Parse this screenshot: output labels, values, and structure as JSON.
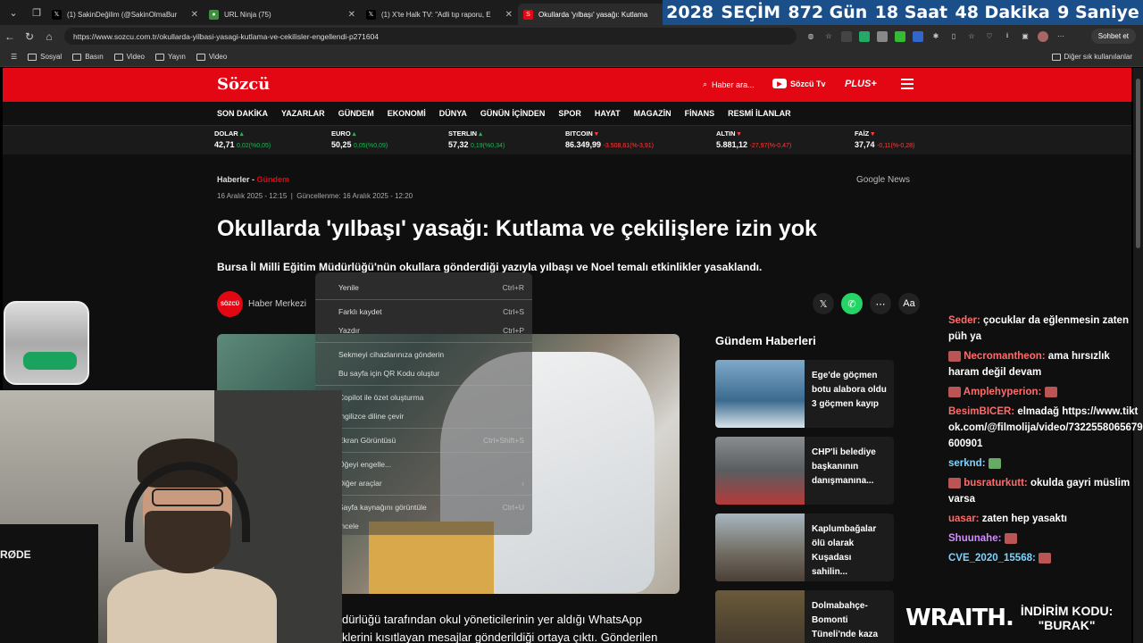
{
  "browser": {
    "tabs": [
      {
        "title": "(1) SakinDeğilim (@SakinOlmaBur",
        "icon": "x-icon",
        "active": false
      },
      {
        "title": "URL Ninja (75)",
        "icon": "url-ninja-icon",
        "active": false
      },
      {
        "title": "(1) X'te Halk TV: \"Adli tıp raporu, E",
        "icon": "x-icon",
        "active": false
      },
      {
        "title": "Okullarda 'yılbaşı' yasağı: Kutlama",
        "icon": "sozcu-icon",
        "active": true
      }
    ],
    "url": "https://www.sozcu.com.tr/okullarda-yilbasi-yasagi-kutlama-ve-cekilisler-engellendi-p271604",
    "chat_button": "Sohbet et",
    "bookmarks": [
      "Sosyal",
      "Basın",
      "Video",
      "Yayın",
      "Video"
    ],
    "bookmarks_other": "Diğer sık kullanılanlar"
  },
  "countdown": {
    "year": "2028",
    "label": "SEÇİM",
    "days": "872 Gün",
    "hours": "18 Saat",
    "minutes": "48 Dakika",
    "seconds": "9 Saniye"
  },
  "site": {
    "logo": "Sözcü",
    "search_placeholder": "Haber ara...",
    "tv": "Sözcü Tv",
    "plus": "PLUS+",
    "menu": [
      "SON DAKİKA",
      "YAZARLAR",
      "GÜNDEM",
      "EKONOMİ",
      "DÜNYA",
      "GÜNÜN İÇİNDEN",
      "SPOR",
      "HAYAT",
      "MAGAZİN",
      "FİNANS",
      "RESMİ İLANLAR"
    ],
    "market": [
      {
        "name": "DOLAR",
        "value": "42,71",
        "change": "0,02(%0,05)",
        "dir": "up"
      },
      {
        "name": "EURO",
        "value": "50,25",
        "change": "0,05(%0,09)",
        "dir": "up"
      },
      {
        "name": "STERLIN",
        "value": "57,32",
        "change": "0,19(%0,34)",
        "dir": "up"
      },
      {
        "name": "BITCOIN",
        "value": "86.349,99",
        "change": "-3.508,61(%-3,91)",
        "dir": "dn"
      },
      {
        "name": "ALTIN",
        "value": "5.881,12",
        "change": "-27,97(%-0,47)",
        "dir": "dn"
      },
      {
        "name": "FAİZ",
        "value": "37,74",
        "change": "-0,11(%-0,28)",
        "dir": "dn"
      }
    ]
  },
  "article": {
    "crumb": "Haberler -",
    "category": "Gündem",
    "published": "16 Aralık 2025 - 12:15",
    "updated": "Güncellenme: 16 Aralık 2025 - 12:20",
    "google_news": "Google News",
    "title": "Okullarda 'yılbaşı' yasağı: Kutlama ve çekilişlere izin yok",
    "subtitle": "Bursa İl Milli Eğitim Müdürlüğü'nün okullara gönderdiği yazıyla yılbaşı ve Noel temalı etkinlikler yasaklandı.",
    "author": "Haber Merkezi",
    "author_badge": "SÖZCÜ",
    "body_line1": "dürlüğü tarafından okul yöneticilerinin yer aldığı WhatsApp",
    "body_line2": "klerini kısıtlayan mesajlar gönderildiği ortaya çıktı. Gönderilen"
  },
  "sidebar": {
    "heading": "Gündem Haberleri",
    "items": [
      {
        "title": "Ege'de göçmen botu alabora oldu 3 göçmen kayıp"
      },
      {
        "title": "CHP'li belediye başkanının danışmanına..."
      },
      {
        "title": "Kaplumbağalar ölü olarak Kuşadası sahilin..."
      },
      {
        "title": "Dolmabahçe-Bomonti Tüneli'nde kaza"
      }
    ]
  },
  "context_menu": [
    {
      "label": "Yenile",
      "key": "Ctrl+R"
    },
    {
      "label": "Farklı kaydet",
      "key": "Ctrl+S"
    },
    {
      "label": "Yazdır",
      "key": "Ctrl+P"
    },
    {
      "label": "Sekmeyi cihazlarınıza gönderin",
      "key": ""
    },
    {
      "label": "Bu sayfa için QR Kodu oluştur",
      "key": ""
    },
    {
      "label": "Copilot ile özet oluşturma",
      "key": ""
    },
    {
      "label": "İngilizce diline çevir",
      "key": ""
    },
    {
      "label": "Ekran Görüntüsü",
      "key": "Ctrl+Shift+S"
    },
    {
      "label": "Öğeyi engelle...",
      "key": ""
    },
    {
      "label": "Diğer araçlar",
      "key": "›"
    },
    {
      "label": "Sayfa kaynağını görüntüle",
      "key": "Ctrl+U"
    },
    {
      "label": "İncele",
      "key": ""
    }
  ],
  "chat": [
    {
      "user": "Seder:",
      "text": "çocuklar da eğlenmesin zaten püh ya"
    },
    {
      "user": "Necromantheon:",
      "text": "ama hırsızlık haram değil devam"
    },
    {
      "user": "Amplehyperion:",
      "text": ""
    },
    {
      "user": "BesimBICER:",
      "text": "elmadağ https://www.tiktok.com/@filmolija/video/7322558065679600901"
    },
    {
      "user": "serknd:",
      "text": ""
    },
    {
      "user": "busraturkutt:",
      "text": "okulda gayri müslim varsa"
    },
    {
      "user": "uasar:",
      "text": "zaten hep yasaktı"
    },
    {
      "user": "Shuunahe:",
      "text": ""
    },
    {
      "user": "CVE_2020_15568:",
      "text": ""
    }
  ],
  "overlay": {
    "brand": "WRAITH.",
    "promo_line1": "İNDİRİM KODU:",
    "promo_line2": "\"BURAK\"",
    "mic_brand": "RØDE"
  }
}
